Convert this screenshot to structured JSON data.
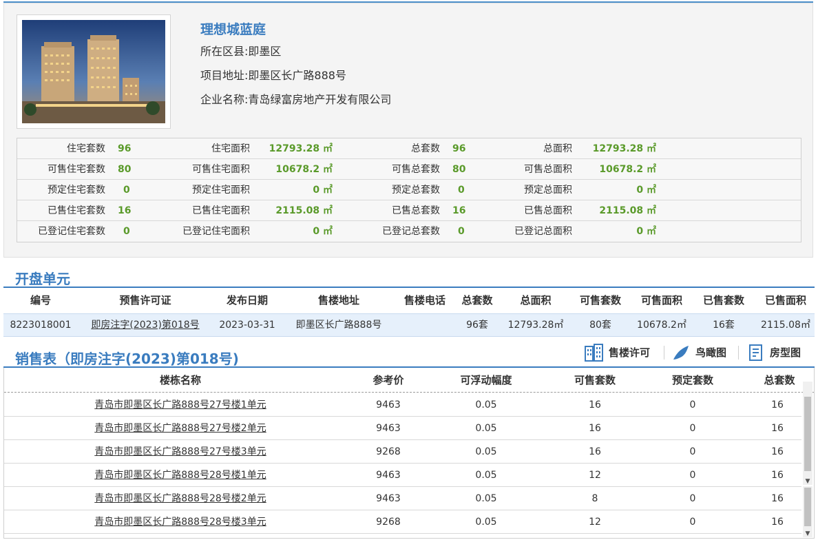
{
  "project": {
    "name": "理想城蓝庭",
    "district_label": "所在区县:",
    "district": "即墨区",
    "address_label": "项目地址:",
    "address": "即墨区长广路888号",
    "company_label": "企业名称:",
    "company": "青岛绿富房地产开发有限公司"
  },
  "stats": [
    [
      {
        "label": "住宅套数",
        "value": "96"
      },
      {
        "label": "住宅面积",
        "value": "12793.28 ㎡"
      },
      {
        "label": "总套数",
        "value": "96"
      },
      {
        "label": "总面积",
        "value": "12793.28 ㎡"
      }
    ],
    [
      {
        "label": "可售住宅套数",
        "value": "80"
      },
      {
        "label": "可售住宅面积",
        "value": "10678.2 ㎡"
      },
      {
        "label": "可售总套数",
        "value": "80"
      },
      {
        "label": "可售总面积",
        "value": "10678.2 ㎡"
      }
    ],
    [
      {
        "label": "预定住宅套数",
        "value": "0"
      },
      {
        "label": "预定住宅面积",
        "value": "0 ㎡"
      },
      {
        "label": "预定总套数",
        "value": "0"
      },
      {
        "label": "预定总面积",
        "value": "0 ㎡"
      }
    ],
    [
      {
        "label": "已售住宅套数",
        "value": "16"
      },
      {
        "label": "已售住宅面积",
        "value": "2115.08 ㎡"
      },
      {
        "label": "已售总套数",
        "value": "16"
      },
      {
        "label": "已售总面积",
        "value": "2115.08 ㎡"
      }
    ],
    [
      {
        "label": "已登记住宅套数",
        "value": "0"
      },
      {
        "label": "已登记住宅面积",
        "value": "0 ㎡"
      },
      {
        "label": "已登记总套数",
        "value": "0"
      },
      {
        "label": "已登记总面积",
        "value": "0 ㎡"
      }
    ]
  ],
  "units": {
    "title": "开盘单元",
    "headers": [
      "编号",
      "预售许可证",
      "发布日期",
      "售楼地址",
      "售楼电话",
      "总套数",
      "总面积",
      "可售套数",
      "可售面积",
      "已售套数",
      "已售面积"
    ],
    "rows": [
      [
        "8223018001",
        "即房注字(2023)第018号",
        "2023-03-31",
        "即墨区长广路888号",
        "",
        "96套",
        "12793.28㎡",
        "80套",
        "10678.2㎡",
        "16套",
        "2115.08㎡"
      ]
    ]
  },
  "sales": {
    "title": "销售表（即房注字(2023)第018号)",
    "tools": {
      "permit": "售楼许可",
      "aerial": "鸟瞰图",
      "floorplan": "房型图"
    },
    "headers": [
      "楼栋名称",
      "参考价",
      "可浮动幅度",
      "可售套数",
      "预定套数",
      "总套数"
    ],
    "rows": [
      [
        "青岛市即墨区长广路888号27号楼1单元",
        "9463",
        "0.05",
        "16",
        "0",
        "16"
      ],
      [
        "青岛市即墨区长广路888号27号楼2单元",
        "9463",
        "0.05",
        "16",
        "0",
        "16"
      ],
      [
        "青岛市即墨区长广路888号27号楼3单元",
        "9268",
        "0.05",
        "16",
        "0",
        "16"
      ],
      [
        "青岛市即墨区长广路888号28号楼1单元",
        "9463",
        "0.05",
        "12",
        "0",
        "16"
      ],
      [
        "青岛市即墨区长广路888号28号楼2单元",
        "9463",
        "0.05",
        "8",
        "0",
        "16"
      ],
      [
        "青岛市即墨区长广路888号28号楼3单元",
        "9268",
        "0.05",
        "12",
        "0",
        "16"
      ]
    ]
  },
  "colors": {
    "accent": "#3a7cbf",
    "value_green": "#5a9a2a",
    "link": "#1a5fc1",
    "row_highlight": "#e6f0fb"
  }
}
